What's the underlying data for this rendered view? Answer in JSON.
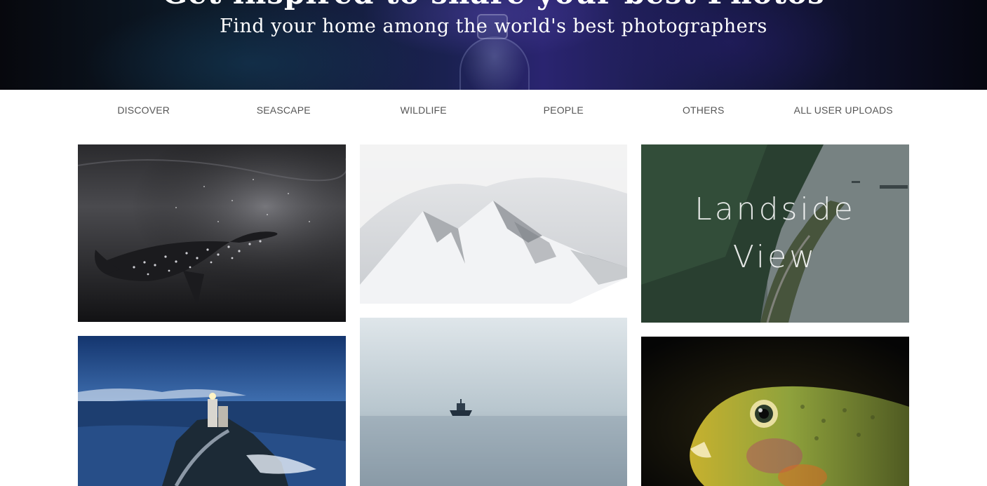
{
  "hero": {
    "title": "Get inspired to share your best Photos",
    "subtitle": "Find your home among the world's best photographers"
  },
  "nav": {
    "items": [
      {
        "label": "DISCOVER"
      },
      {
        "label": "SEASCAPE"
      },
      {
        "label": "WILDLIFE"
      },
      {
        "label": "PEOPLE"
      },
      {
        "label": "OTHERS"
      },
      {
        "label": "ALL USER UPLOADS"
      }
    ]
  },
  "gallery": {
    "landside_overlay": {
      "line1": "Landside",
      "line2": "View"
    }
  },
  "colors": {
    "nav_text": "#555555",
    "page_background": "#ffffff",
    "hero_background": "#1a2150"
  }
}
